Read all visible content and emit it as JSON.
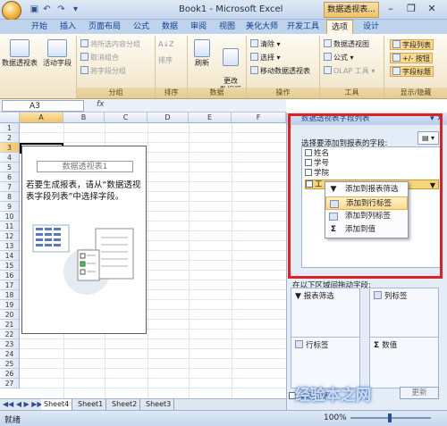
{
  "title_bar": {
    "title": "Book1 - Microsoft Excel",
    "context_tab_title": "数据透视表..."
  },
  "tabs": [
    "开始",
    "插入",
    "页面布局",
    "公式",
    "数据",
    "审阅",
    "视图",
    "美化大师",
    "开发工具",
    "选项",
    "设计"
  ],
  "active_tab": "选项",
  "ribbon": {
    "pivot_table_label": "数据透视表",
    "active_field_label": "活动字段",
    "group_btn_group_selection": "将所选内容分组",
    "group_btn_ungroup": "取消组合",
    "group_btn_group_field": "将字段分组",
    "group_label_group": "分组",
    "sort_label": "排序",
    "group_label_sort": "排序",
    "refresh_label": "刷新",
    "change_source_label": "更改\n数据源",
    "group_label_data": "数据",
    "clear_label": "清除",
    "select_label": "选择",
    "move_label": "移动数据透视表",
    "group_label_actions": "操作",
    "pivot_chart_label": "数据透视图",
    "formula_label": "公式",
    "olap_label": "OLAP 工具",
    "group_label_tools": "工具",
    "field_list_label": "字段列表",
    "plus_minus_label": "+/- 按钮",
    "field_header_label": "字段标题",
    "group_label_show_hide": "显示/隐藏"
  },
  "formula_bar": {
    "name_box": "A3",
    "fx": "fx"
  },
  "grid": {
    "columns": [
      "A",
      "B",
      "C",
      "D",
      "E",
      "F"
    ],
    "rows": [
      "1",
      "2",
      "3",
      "4",
      "5",
      "6",
      "7",
      "8",
      "9",
      "10",
      "11",
      "12",
      "13",
      "14",
      "15",
      "16",
      "17",
      "18",
      "19",
      "20",
      "21",
      "22",
      "23",
      "24",
      "25",
      "26",
      "27"
    ]
  },
  "pivot_placeholder": {
    "title": "数据透视表1",
    "hint": "若要生成报表，请从“数据透视表字段列表”中选择字段。"
  },
  "sheet_tabs": [
    "Sheet4",
    "Sheet1",
    "Sheet2",
    "Sheet3"
  ],
  "status": {
    "left": "就绪",
    "zoom": "100%"
  },
  "task_pane": {
    "header": "数据透视表字段列表",
    "choose_label": "选择要添加到报表的字段:",
    "fields": [
      "姓名",
      "学号",
      "学院",
      "工"
    ],
    "context_menu": [
      "添加到报表筛选",
      "添加到行标签",
      "添加到列标签",
      "添加到值"
    ],
    "drag_label": "在以下区域间拖动字段:",
    "zones": {
      "report_filter": "报表筛选",
      "column_labels": "列标签",
      "row_labels": "行标签",
      "values": "数值"
    },
    "defer_label": "推迟布局",
    "update_label": "更新"
  },
  "watermark": "经验本之网"
}
